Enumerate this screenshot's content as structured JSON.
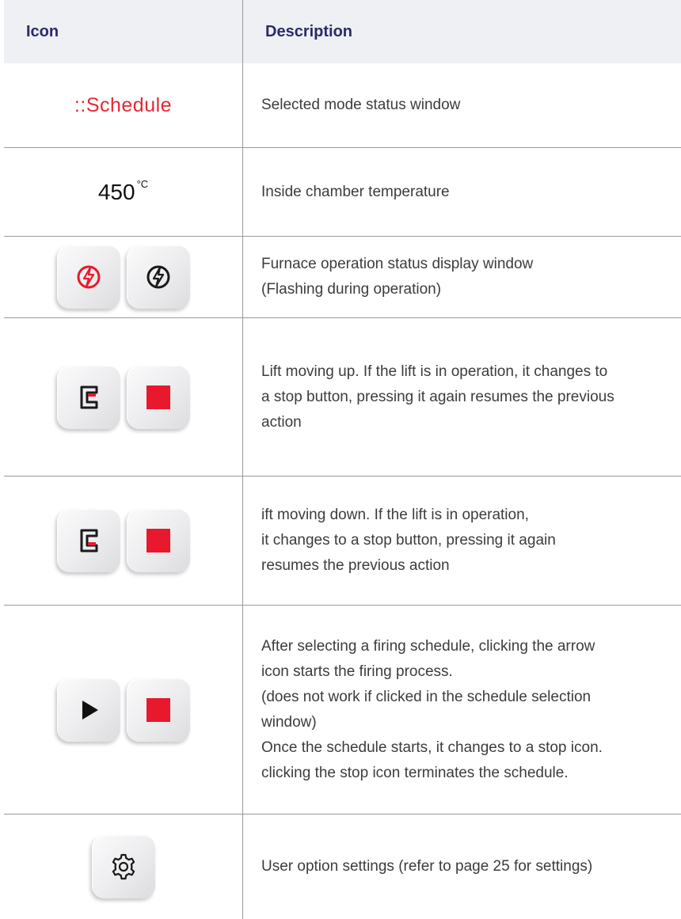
{
  "header": {
    "icon": "Icon",
    "description": "Description"
  },
  "rows": [
    {
      "schedule_text": "::Schedule",
      "description": "Selected mode status window"
    },
    {
      "temperature": "450",
      "unit": "°C",
      "description": "Inside chamber temperature"
    },
    {
      "icons": [
        "bolt-icon-red",
        "bolt-icon-black"
      ],
      "description": [
        "Furnace operation status display window",
        "(Flashing during operation)"
      ]
    },
    {
      "icons": [
        "lift-up-icon",
        "stop-icon"
      ],
      "description": [
        "Lift moving up. If the lift is in operation, it changes to",
        "a stop button, pressing it again resumes the previous",
        "action"
      ]
    },
    {
      "icons": [
        "lift-down-icon",
        "stop-icon"
      ],
      "description": [
        "ift moving down.  If the lift is in operation,",
        "it changes to a stop button, pressing it again",
        "resumes the previous action"
      ]
    },
    {
      "icons": [
        "play-icon",
        "stop-icon"
      ],
      "description": [
        "After selecting a firing schedule, clicking the arrow",
        "icon starts the firing process.",
        "(does not work if clicked in the schedule selection",
        "window)",
        "Once the schedule starts, it changes to a stop icon.",
        "clicking the stop icon terminates the schedule."
      ]
    },
    {
      "icons": [
        "gear-icon"
      ],
      "description": "User option settings (refer to page 25 for settings)"
    }
  ],
  "colors": {
    "accent_red": "#e8192c",
    "header_text": "#2a2a6e",
    "header_bg": "#eff0f3"
  }
}
